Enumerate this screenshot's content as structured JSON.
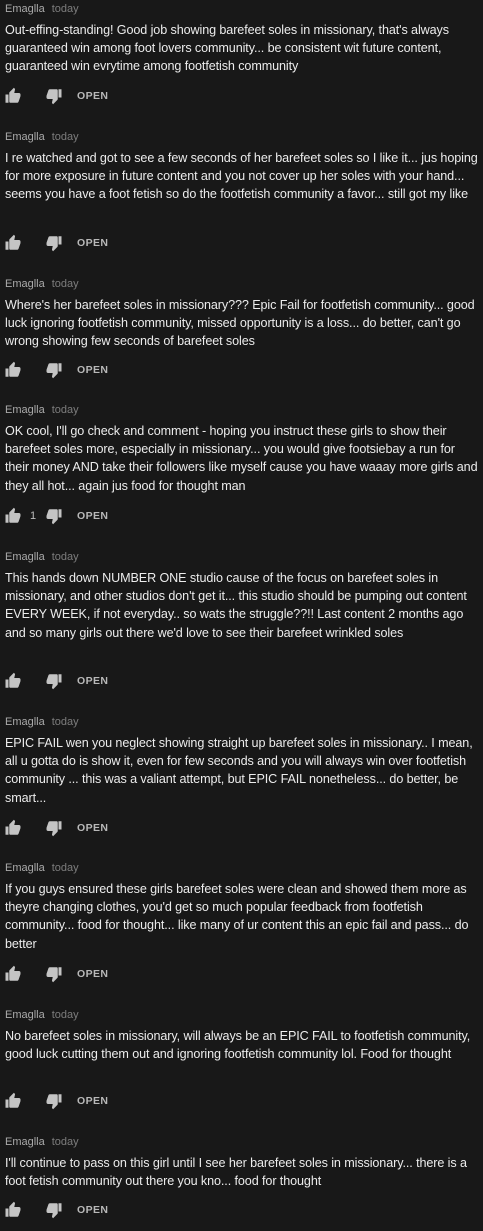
{
  "comments": [
    {
      "author": "Emaglla",
      "date": "today",
      "text": "Out-effing-standing! Good job showing barefeet soles in missionary, that's always guaranteed win among foot lovers community... be consistent wit future content, guaranteed win evrytime among footfetish community",
      "likes": "",
      "open_label": "OPEN"
    },
    {
      "author": "Emaglla",
      "date": "today",
      "text": "I re watched and got to see a few seconds of her barefeet soles so I like it... jus hoping for more exposure in future content and you not cover up her soles with your hand... seems you have a foot fetish so do the footfetish community a favor... still got my like",
      "likes": "",
      "open_label": "OPEN"
    },
    {
      "author": "Emaglla",
      "date": "today",
      "text": "Where's her barefeet soles in missionary??? Epic Fail for footfetish community... good luck ignoring footfetish community, missed opportunity is a loss... do better, can't go wrong showing few seconds of barefeet soles",
      "likes": "",
      "open_label": "OPEN"
    },
    {
      "author": "Emaglla",
      "date": "today",
      "text": "OK cool, I'll go check and comment - hoping you instruct these girls to show their barefeet soles more, especially in missionary... you would give footsiebay a run for their money AND take their followers like myself cause you have waaay more girls and they all hot... again jus food for thought man",
      "likes": "1",
      "open_label": "OPEN"
    },
    {
      "author": "Emaglla",
      "date": "today",
      "text": "This hands down NUMBER ONE studio cause of the focus on barefeet soles in missionary, and other studios don't get it... this studio should be pumping out content EVERY WEEK, if not everyday.. so wats the struggle??!! Last content 2 months ago and so many girls out there we'd love to see their barefeet wrinkled soles",
      "likes": "",
      "open_label": "OPEN"
    },
    {
      "author": "Emaglla",
      "date": "today",
      "text": "EPIC FAIL wen you neglect showing straight up barefeet soles in missionary.. I mean, all u gotta do is show it, even for few seconds and you will always win over footfetish community ... this was a valiant attempt, but EPIC FAIL nonetheless... do better, be smart...",
      "likes": "",
      "open_label": "OPEN"
    },
    {
      "author": "Emaglla",
      "date": "today",
      "text": "If you guys ensured these girls barefeet soles were clean and showed them more as theyre changing clothes, you'd get so much popular feedback from footfetish community... food for thought... like many of ur content this an epic fail and pass... do better",
      "likes": "",
      "open_label": "OPEN"
    },
    {
      "author": "Emaglla",
      "date": "today",
      "text": "No barefeet soles in missionary, will always be an EPIC FAIL to footfetish community, good luck cutting them out and ignoring footfetish community lol. Food for thought",
      "likes": "",
      "open_label": "OPEN"
    },
    {
      "author": "Emaglla",
      "date": "today",
      "text": "I'll continue to pass on this girl until I see her barefeet soles in missionary... there is a foot fetish community out there you kno... food for thought",
      "likes": "",
      "open_label": "OPEN"
    }
  ],
  "icons": {
    "like": "thumbs-up-icon",
    "dislike": "thumbs-down-icon"
  },
  "colors": {
    "background": "#181818",
    "author": "#aaaaaa",
    "date": "#7d7d7d",
    "text": "#ececec",
    "icon": "#c4c4c4"
  }
}
